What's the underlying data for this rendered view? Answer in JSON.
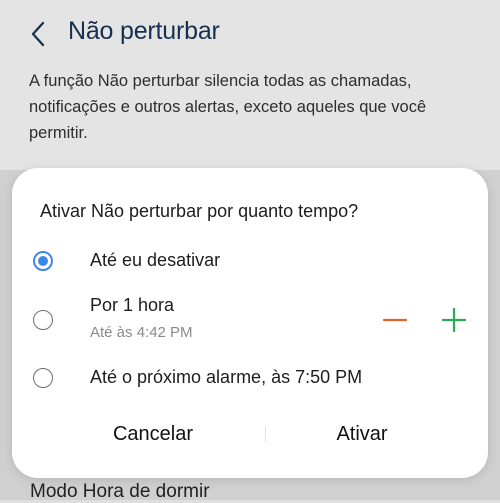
{
  "header": {
    "title": "Não perturbar"
  },
  "description": "A função Não perturbar silencia todas as chamadas, notificações e outros alertas, exceto aqueles que você permitir.",
  "background": {
    "bottom_item": "Modo Hora de dormir"
  },
  "dialog": {
    "title": "Ativar Não perturbar por quanto tempo?",
    "options": [
      {
        "label": "Até eu desativar",
        "selected": true
      },
      {
        "label": "Por 1 hora",
        "sublabel": "Até às 4:42 PM",
        "selected": false
      },
      {
        "label": "Até o próximo alarme, às 7:50 PM",
        "selected": false
      }
    ],
    "stepper": {
      "decrement_icon": "minus-icon",
      "increment_icon": "plus-icon"
    },
    "cancel_label": "Cancelar",
    "confirm_label": "Ativar"
  },
  "colors": {
    "accent": "#3e86e8",
    "title": "#16314f",
    "minus": "#e0632d",
    "plus": "#2aaa55"
  }
}
